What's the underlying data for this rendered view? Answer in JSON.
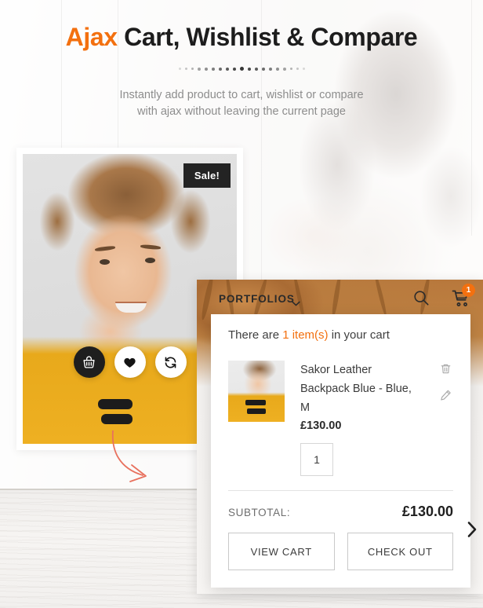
{
  "hero": {
    "title_accent": "Ajax",
    "title_rest": " Cart, Wishlist & Compare",
    "subtitle_line1": "Instantly add product to cart, wishlist or compare",
    "subtitle_line2": "with ajax without leaving the current page",
    "accent_color": "#f3700f",
    "dot_count": 19,
    "dot_active_index": 9
  },
  "product_card": {
    "sale_badge": "Sale!",
    "actions": [
      {
        "name": "add-to-cart",
        "icon": "basket-icon",
        "active": true
      },
      {
        "name": "add-to-wishlist",
        "icon": "heart-icon",
        "active": false
      },
      {
        "name": "add-to-compare",
        "icon": "compare-icon",
        "active": false
      }
    ]
  },
  "nav": {
    "menu_label": "PORTFOLIOS",
    "caret_icon": "chevron-down-icon",
    "search_icon": "search-icon",
    "cart_icon": "shopping-cart-icon",
    "cart_count": "1",
    "badge_color": "#f3700f"
  },
  "cart_panel": {
    "heading_prefix": "There are ",
    "heading_highlight": "1 item(s)",
    "heading_suffix": " in your cart",
    "item": {
      "name": "Sakor Leather Backpack Blue - Blue, M",
      "price": "£130.00",
      "quantity": "1",
      "delete_icon": "trash-icon",
      "edit_icon": "pencil-icon"
    },
    "subtotal_label": "SUBTOTAL:",
    "subtotal_value": "£130.00",
    "view_cart_label": "VIEW CART",
    "checkout_label": "CHECK OUT"
  },
  "slider": {
    "next_icon": "chevron-right-icon"
  }
}
